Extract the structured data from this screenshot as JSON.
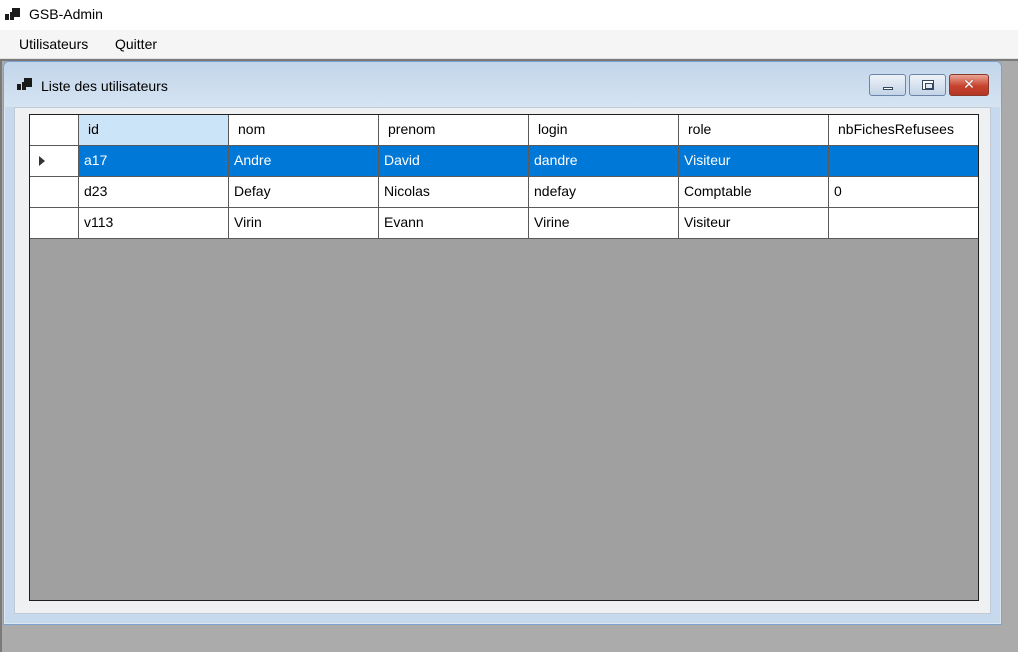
{
  "app": {
    "title": "GSB-Admin"
  },
  "menu": {
    "items": [
      "Utilisateurs",
      "Quitter"
    ]
  },
  "child_window": {
    "title": "Liste des utilisateurs"
  },
  "grid": {
    "columns": [
      "id",
      "nom",
      "prenom",
      "login",
      "role",
      "nbFichesRefusees"
    ],
    "rows": [
      [
        "a17",
        "Andre",
        "David",
        "dandre",
        "Visiteur",
        ""
      ],
      [
        "d23",
        "Defay",
        "Nicolas",
        "ndefay",
        "Comptable",
        "0"
      ],
      [
        "v113",
        "Virin",
        "Evann",
        "Virine",
        "Visiteur",
        ""
      ]
    ],
    "selected_row": 0,
    "selection_color": "#0078d7"
  }
}
